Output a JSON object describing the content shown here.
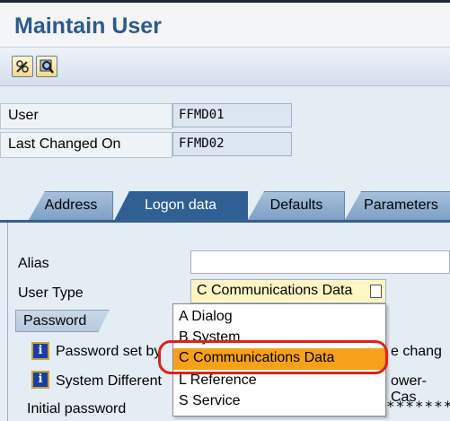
{
  "window": {
    "title": "Maintain User"
  },
  "toolbar": {
    "buttons": [
      {
        "icon": "edit-glasses-icon"
      },
      {
        "icon": "display-magnifier-icon"
      }
    ]
  },
  "fields": {
    "user": {
      "label": "User",
      "value": "FFMD01"
    },
    "last_changed": {
      "label": "Last Changed On",
      "value": "FFMD02"
    }
  },
  "tabs": [
    {
      "label": "Address",
      "active": false
    },
    {
      "label": "Logon data",
      "active": true
    },
    {
      "label": "Defaults",
      "active": false
    },
    {
      "label": "Parameters",
      "active": false
    }
  ],
  "logon": {
    "alias_label": "Alias",
    "alias_value": "",
    "user_type_label": "User Type",
    "user_type_value": "C Communications Data",
    "password_tab": "Password",
    "rows": [
      {
        "text": "Password set by",
        "suffix": "e chang"
      },
      {
        "text": "System Different",
        "suffix": "ower-Cas"
      }
    ],
    "initial_password_label": "Initial password",
    "initial_password_value": "********"
  },
  "dropdown": {
    "items": [
      {
        "code": "A",
        "label": "Dialog",
        "selected": false
      },
      {
        "code": "B",
        "label": "System",
        "selected": false
      },
      {
        "code": "C",
        "label": "Communications Data",
        "selected": true
      },
      {
        "code": "L",
        "label": "Reference",
        "selected": false
      },
      {
        "code": "S",
        "label": "Service",
        "selected": false
      }
    ]
  },
  "colors": {
    "accent": "#2d5a8c",
    "selected": "#f7a11a",
    "annotation": "#e0201c"
  }
}
